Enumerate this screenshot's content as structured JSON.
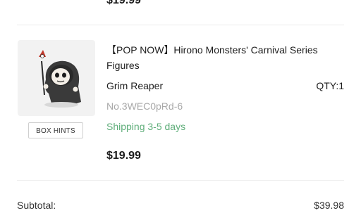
{
  "previous_item": {
    "price": "$19.99"
  },
  "item": {
    "title": "【POP NOW】Hirono Monsters' Carnival Series Figures",
    "variant": "Grim Reaper",
    "quantity": "QTY:1",
    "sku": "No.3WEC0pRd-6",
    "shipping": "Shipping 3-5 days",
    "price": "$19.99",
    "box_hints_label": "BOX HINTS",
    "image_icon": "grim-reaper-figure-image"
  },
  "summary": {
    "subtotal_label": "Subtotal:",
    "subtotal_value": "$39.98"
  },
  "colors": {
    "shipping_text": "#5fae7a",
    "sku_text": "#a8a8a8",
    "thumb_bg": "#f2f2f2"
  }
}
